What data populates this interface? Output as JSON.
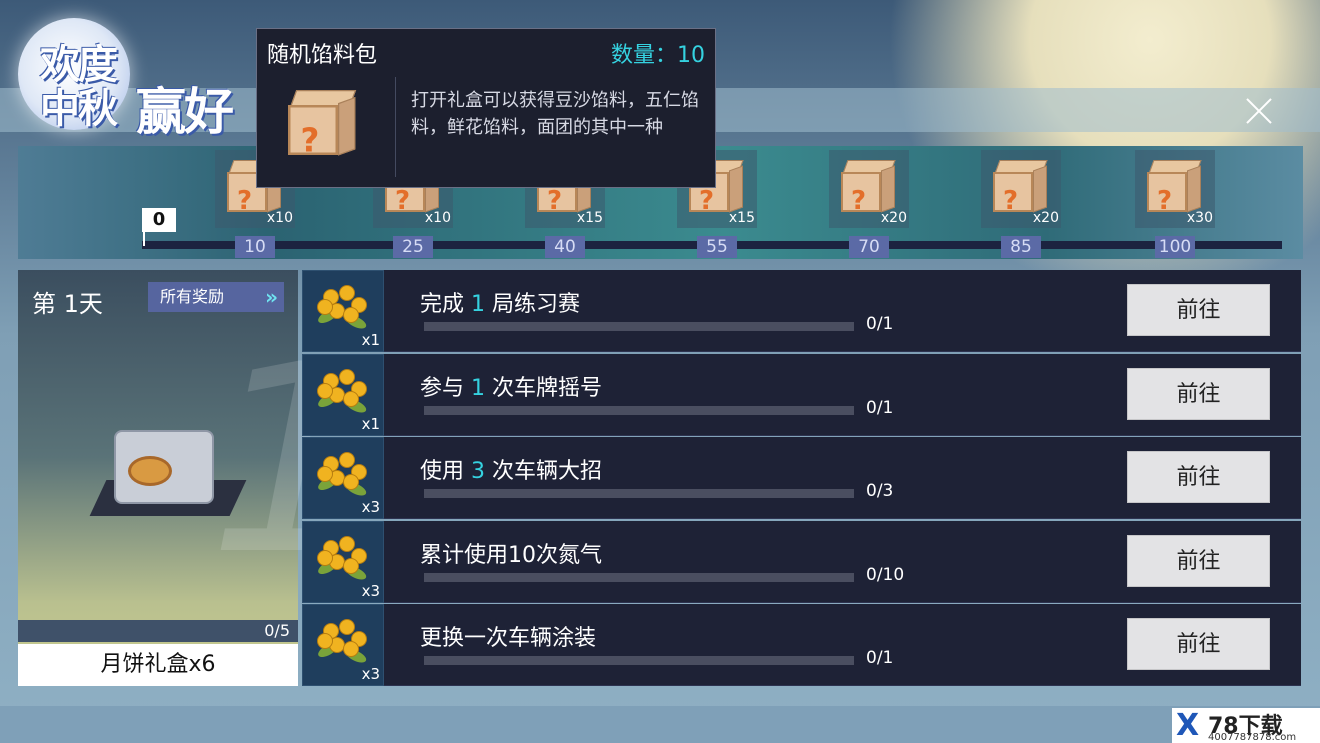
{
  "logo": {
    "line1": "欢度",
    "line2": "中秋",
    "line3": "赢好"
  },
  "tooltip": {
    "title": "随机馅料包",
    "quantity": "数量：10",
    "description": "打开礼盒可以获得豆沙馅料，五仁馅料，鲜花馅料，面团的其中一种"
  },
  "progress_track": {
    "current": "0",
    "milestones": [
      {
        "threshold": "10",
        "count": "x10"
      },
      {
        "threshold": "25",
        "count": "x10"
      },
      {
        "threshold": "40",
        "count": "x15"
      },
      {
        "threshold": "55",
        "count": "x15"
      },
      {
        "threshold": "70",
        "count": "x20"
      },
      {
        "threshold": "85",
        "count": "x20"
      },
      {
        "threshold": "100",
        "count": "x30"
      }
    ]
  },
  "day_card": {
    "day_label": "第 1天",
    "all_rewards": "所有奖励",
    "chevron": "»",
    "big_number": "1",
    "progress": "0/5",
    "reward_name": "月饼礼盒x6"
  },
  "tasks": [
    {
      "pre": "完成 ",
      "num": "1",
      "post": " 局练习赛",
      "progress": "0/1",
      "fraction": 0,
      "reward_count": "x1",
      "button": "前往"
    },
    {
      "pre": "参与 ",
      "num": "1",
      "post": " 次车牌摇号",
      "progress": "0/1",
      "fraction": 0,
      "reward_count": "x1",
      "button": "前往"
    },
    {
      "pre": "使用 ",
      "num": "3",
      "post": " 次车辆大招",
      "progress": "0/3",
      "fraction": 0,
      "reward_count": "x3",
      "button": "前往"
    },
    {
      "pre": "累计使用10次氮气",
      "num": "",
      "post": "",
      "progress": "0/10",
      "fraction": 0,
      "reward_count": "x3",
      "button": "前往"
    },
    {
      "pre": "更换一次车辆涂装",
      "num": "",
      "post": "",
      "progress": "0/1",
      "fraction": 0,
      "reward_count": "x3",
      "button": "前往"
    }
  ],
  "watermark": {
    "x": "X",
    "title": "78下载",
    "site": "4007787878.com"
  },
  "colors": {
    "accent": "#35d2e0",
    "panel": "#1e2236",
    "button": "#e3e3e5"
  }
}
